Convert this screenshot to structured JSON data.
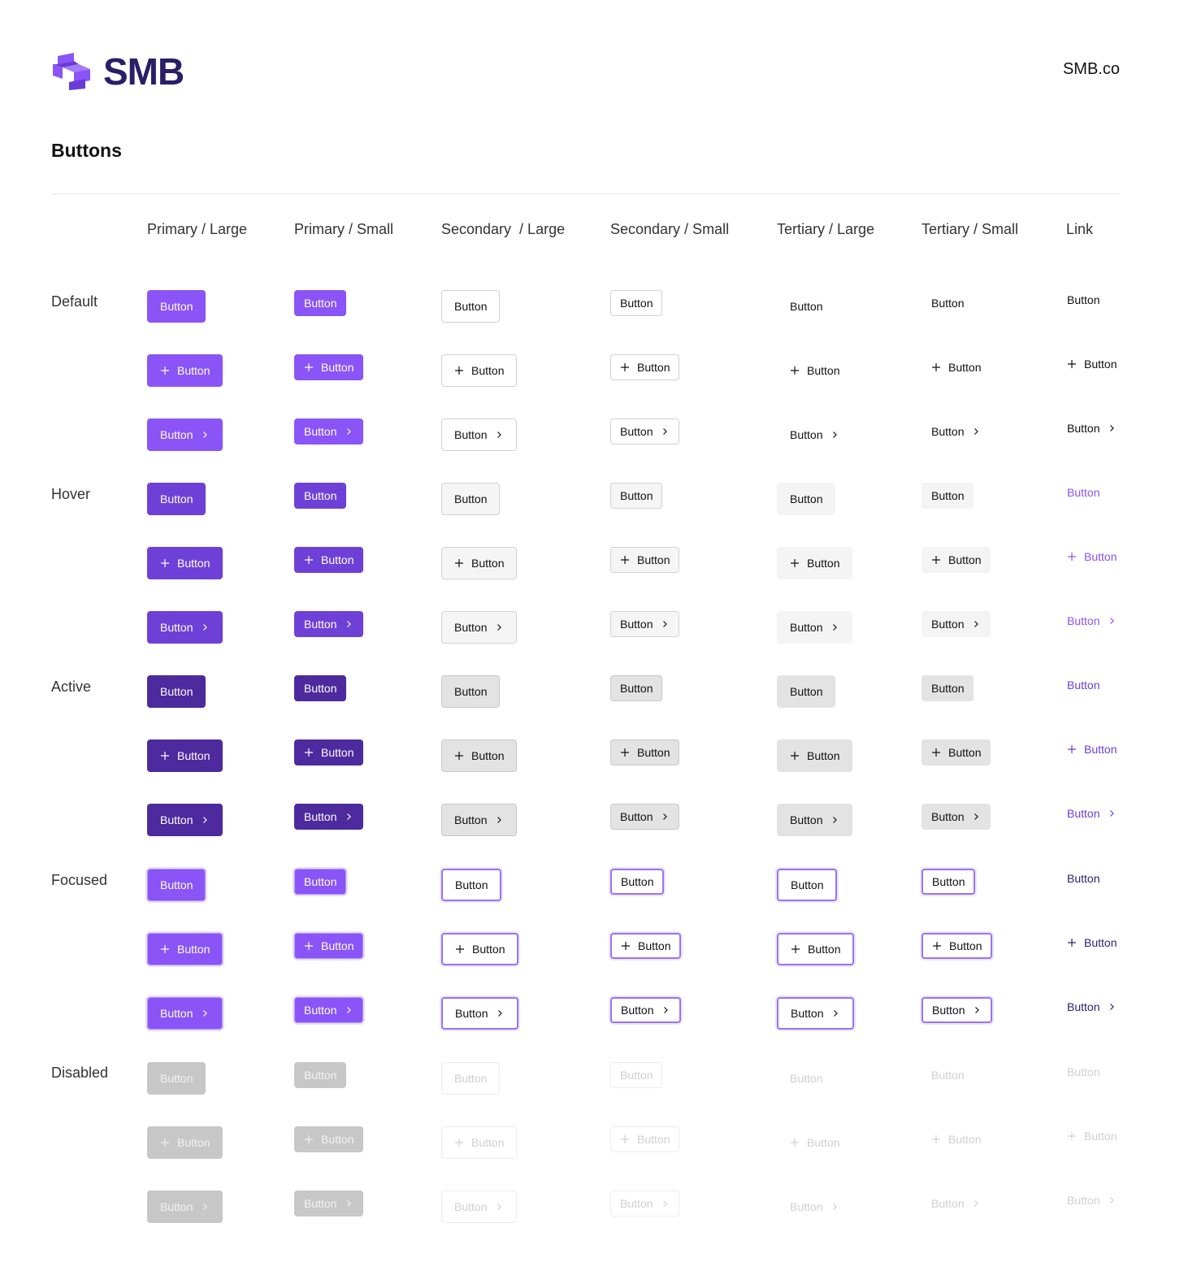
{
  "header": {
    "logo_text": "SMB",
    "site_link": "SMB.co",
    "brand_color": "#2a1e67",
    "logo_mark_color": "#8a54f7"
  },
  "page": {
    "title": "Buttons"
  },
  "columns": [
    {
      "key": "primary-large",
      "label": "Primary / Large"
    },
    {
      "key": "primary-small",
      "label": "Primary / Small"
    },
    {
      "key": "secondary-large",
      "label": "Secondary  / Large"
    },
    {
      "key": "secondary-small",
      "label": "Secondary / Small"
    },
    {
      "key": "tertiary-large",
      "label": "Tertiary / Large"
    },
    {
      "key": "tertiary-small",
      "label": "Tertiary / Small"
    },
    {
      "key": "link",
      "label": "Link"
    }
  ],
  "states": [
    {
      "key": "default",
      "label": "Default"
    },
    {
      "key": "hover",
      "label": "Hover"
    },
    {
      "key": "active",
      "label": "Active"
    },
    {
      "key": "focused",
      "label": "Focused"
    },
    {
      "key": "disabled",
      "label": "Disabled"
    }
  ],
  "variants": [
    "text-only",
    "leading-plus-icon",
    "trailing-chevron-icon"
  ],
  "icons": {
    "leading": "plus-icon",
    "trailing": "chevron-right-icon"
  },
  "button_label": "Button",
  "colors": {
    "primary_default": "#8a54f7",
    "primary_hover": "#6f40d8",
    "primary_active": "#4d2a9e",
    "disabled": "#c7c7c7"
  }
}
